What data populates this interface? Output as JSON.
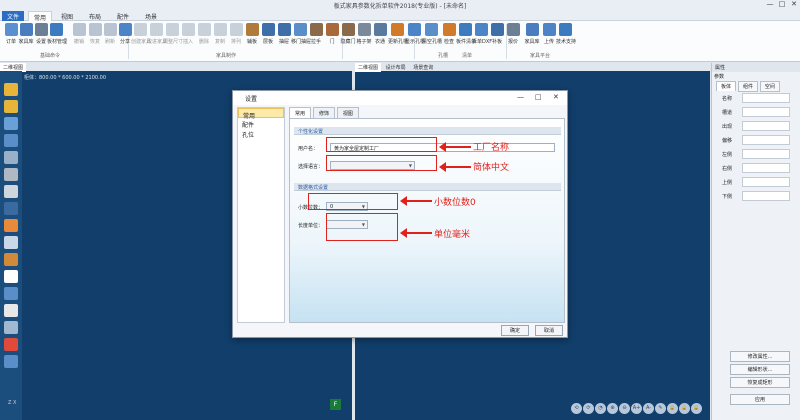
{
  "window": {
    "title": "板式家具参数化拆单软件2018(专业版) - [未命名]",
    "minimize": "—",
    "maximize": "□",
    "close": "✕"
  },
  "menu": {
    "items": [
      "文件",
      "常用",
      "视图",
      "布局",
      "配件",
      "场景"
    ],
    "active": "常用"
  },
  "ribbon": {
    "buttons": [
      {
        "label": "订单",
        "color": "#5b8fd0",
        "enabled": true
      },
      {
        "label": "家具库",
        "color": "#4a7dc0",
        "enabled": true
      },
      {
        "label": "设置",
        "color": "#6c7f94",
        "enabled": true
      },
      {
        "label": "板材管理",
        "color": "#3c7bbf",
        "enabled": true
      },
      {
        "label": "撤销",
        "color": "#b8c4d2",
        "enabled": false
      },
      {
        "label": "恢复",
        "color": "#b8c4d2",
        "enabled": false
      },
      {
        "label": "刷新",
        "color": "#b8c4d2",
        "enabled": false
      },
      {
        "label": "分享",
        "color": "#4c84c8",
        "enabled": true
      },
      {
        "label": "创建家具",
        "color": "#c8d0da",
        "enabled": false
      },
      {
        "label": "改进家具",
        "color": "#c8d0da",
        "enabled": false
      },
      {
        "label": "调整尺寸",
        "color": "#c8d0da",
        "enabled": false
      },
      {
        "label": "插入",
        "color": "#c8d0da",
        "enabled": false
      },
      {
        "label": "删除",
        "color": "#c8d0da",
        "enabled": false
      },
      {
        "label": "复制",
        "color": "#c8d0da",
        "enabled": false
      },
      {
        "label": "排列",
        "color": "#c8d0da",
        "enabled": false
      },
      {
        "label": "辅板",
        "color": "#b07a3a",
        "enabled": true
      },
      {
        "label": "层板",
        "color": "#3f6fa8",
        "enabled": true
      },
      {
        "label": "抽屉",
        "color": "#3f6fa8",
        "enabled": true
      },
      {
        "label": "移门抽屉",
        "color": "#5a8ec8",
        "enabled": true
      },
      {
        "label": "拉手",
        "color": "#8a6a4a",
        "enabled": true
      },
      {
        "label": "门",
        "color": "#a86a3a",
        "enabled": true
      },
      {
        "label": "隐藏门",
        "color": "#8a6a4a",
        "enabled": true
      },
      {
        "label": "格子架",
        "color": "#7a8a9a",
        "enabled": true
      },
      {
        "label": "衣通",
        "color": "#5a7aa0",
        "enabled": true
      },
      {
        "label": "更新孔槽",
        "color": "#d07a2a",
        "enabled": true
      },
      {
        "label": "显示孔槽",
        "color": "#4c84c8",
        "enabled": true
      },
      {
        "label": "清空孔槽",
        "color": "#5a8ec8",
        "enabled": true
      },
      {
        "label": "检查",
        "color": "#d07a2a",
        "enabled": true
      },
      {
        "label": "板件清单",
        "color": "#3c7bbf",
        "enabled": true
      },
      {
        "label": "拆单DXF",
        "color": "#4c84c8",
        "enabled": true
      },
      {
        "label": "补板",
        "color": "#3f6fa8",
        "enabled": true
      },
      {
        "label": "报价",
        "color": "#6c7f94",
        "enabled": true
      },
      {
        "label": "家具库",
        "color": "#4a7dc0",
        "enabled": true
      },
      {
        "label": "上传",
        "color": "#4c84c8",
        "enabled": true
      },
      {
        "label": "技术支持",
        "color": "#3c7bbf",
        "enabled": true
      }
    ],
    "groups": [
      "基础命令",
      "家具制作",
      "孔槽",
      "清单",
      "家具平台"
    ]
  },
  "left_view": {
    "tabs": [
      "二维视图"
    ],
    "coord": "柜体：800.00 * 600.00 * 2100.00",
    "axis_x": "X",
    "axis_z": "Z",
    "tool_colors": [
      "#e8b43a",
      "#e8b43a",
      "#6aa0d8",
      "#5a8ec8",
      "#9ab0c8",
      "#b0b8c4",
      "#d0d6de",
      "#3a6aa0",
      "#e88a3a",
      "#c8d8e8",
      "#d08a3a",
      "#ffffff",
      "#5a8ec8",
      "#e8e8e8",
      "#a0b8d0",
      "#e04a3a",
      "#5a8ec8"
    ]
  },
  "right_view": {
    "tabs": [
      "二维视图",
      "设计布局",
      "场景查询"
    ],
    "badge": "F",
    "tools": [
      "⟲",
      "⟳",
      "◔",
      "⊕",
      "⊖",
      "A+",
      "A-",
      "✎",
      "🔒",
      "🔓",
      "🔒"
    ]
  },
  "property_panel": {
    "title": "属性",
    "subtitle": "参数",
    "tabs": [
      "板体",
      "组件",
      "空间"
    ],
    "fields": [
      "名称",
      "槽道",
      "出现",
      "偏移",
      "左侧",
      "右侧",
      "上侧",
      "下侧"
    ],
    "buttons": [
      "修改属性...",
      "编辑形状...",
      "恢复成矩形",
      "应用"
    ]
  },
  "dialog": {
    "title": "设置",
    "nav": [
      "常用",
      "配件",
      "孔位"
    ],
    "nav_selected": "常用",
    "tabs": [
      "常用",
      "修饰",
      "视图"
    ],
    "section_personal": "个性化设置",
    "user_label": "用户名：",
    "user_value": "黄为家全屋定制工厂",
    "lang_label": "选择语言：",
    "section_format": "数据格式设置",
    "decimal_label": "小数位数：",
    "decimal_value": "0",
    "unit_label": "长度单位：",
    "ok": "确定",
    "cancel": "取消",
    "min": "—",
    "max": "□",
    "close": "✕"
  },
  "annotations": {
    "factory_name": "工厂名称",
    "language": "简体中文",
    "decimal": "小数位数0",
    "unit": "单位毫米"
  }
}
